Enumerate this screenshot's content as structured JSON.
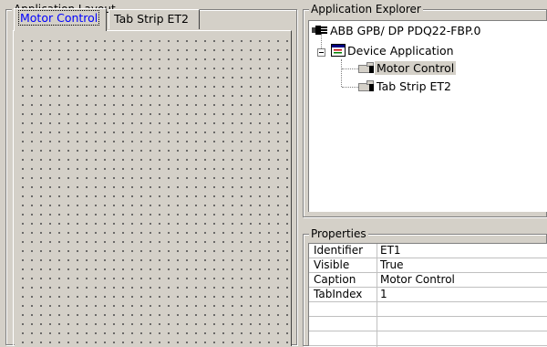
{
  "layout_panel": {
    "title": "Application Layout",
    "tabs": [
      {
        "label": "Motor Control",
        "selected": true
      },
      {
        "label": "Tab Strip ET2",
        "selected": false
      }
    ]
  },
  "explorer_panel": {
    "title": "Application Explorer",
    "tree": [
      {
        "label": "ABB GPB/ DP PDQ22-FBP.0",
        "icon": "network-device-icon",
        "level": 0
      },
      {
        "label": "Device Application",
        "icon": "application-window-icon",
        "level": 1,
        "expanded": true
      },
      {
        "label": "Motor Control",
        "icon": "tab-page-icon",
        "level": 2,
        "selected": true
      },
      {
        "label": "Tab Strip ET2",
        "icon": "tab-page-icon",
        "level": 2
      }
    ]
  },
  "properties_panel": {
    "title": "Properties",
    "rows": [
      {
        "name": "Identifier",
        "value": "ET1"
      },
      {
        "name": "Visible",
        "value": "True"
      },
      {
        "name": "Caption",
        "value": "Motor Control"
      },
      {
        "name": "TabIndex",
        "value": "1"
      },
      {
        "name": "",
        "value": ""
      },
      {
        "name": "",
        "value": ""
      },
      {
        "name": "",
        "value": ""
      }
    ]
  },
  "colors": {
    "window_bg": "#d4d0c8",
    "selected_tab_text": "#0000ff",
    "pane_bg": "#ffffff",
    "grid_line": "#c0c0c0"
  }
}
